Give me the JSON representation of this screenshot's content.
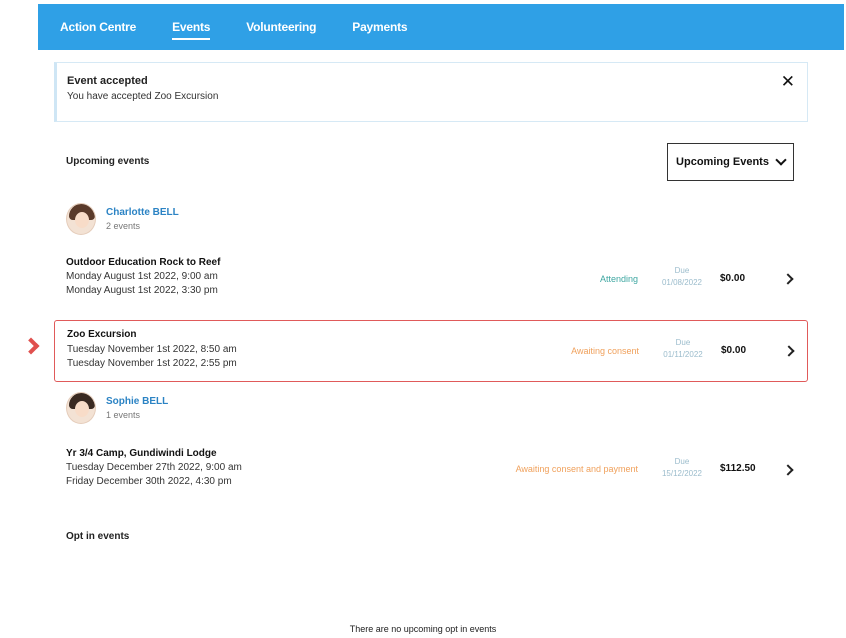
{
  "nav": {
    "tabs": [
      {
        "label": "Action Centre",
        "active": false
      },
      {
        "label": "Events",
        "active": true
      },
      {
        "label": "Volunteering",
        "active": false
      },
      {
        "label": "Payments",
        "active": false
      }
    ]
  },
  "alert": {
    "title": "Event accepted",
    "message": "You have accepted Zoo Excursion",
    "close_icon": "close-icon"
  },
  "upcoming": {
    "title": "Upcoming events",
    "filter_label": "Upcoming Events",
    "filter_icon": "chevron-down-icon"
  },
  "students": [
    {
      "name": "Charlotte BELL",
      "count": "2 events",
      "events": [
        {
          "name": "Outdoor Education Rock to Reef",
          "start": "Monday August 1st 2022, 9:00 am",
          "end": "Monday August 1st 2022, 3:30 pm",
          "status": "Attending",
          "due_label": "Due",
          "due_date": "01/08/2022",
          "price": "$0.00"
        },
        {
          "name": "Zoo Excursion",
          "start": "Tuesday November 1st 2022, 8:50 am",
          "end": "Tuesday November 1st 2022, 2:55 pm",
          "status": "Awaiting consent",
          "due_label": "Due",
          "due_date": "01/11/2022",
          "price": "$0.00"
        }
      ]
    },
    {
      "name": "Sophie BELL",
      "count": "1 events",
      "events": [
        {
          "name": "Yr 3/4 Camp, Gundiwindi Lodge",
          "start": "Tuesday December 27th 2022, 9:00 am",
          "end": "Friday December 30th 2022, 4:30 pm",
          "status": "Awaiting consent and payment",
          "due_label": "Due",
          "due_date": "15/12/2022",
          "price": "$112.50"
        }
      ]
    }
  ],
  "opt_in": {
    "title": "Opt in events",
    "empty_message": "There are no upcoming opt in events"
  },
  "colors": {
    "nav_bg": "#2fa0e6",
    "link": "#2b83c4",
    "attending": "#3fa7a2",
    "awaiting": "#f0a15c",
    "highlight_border": "#e05a5a"
  }
}
